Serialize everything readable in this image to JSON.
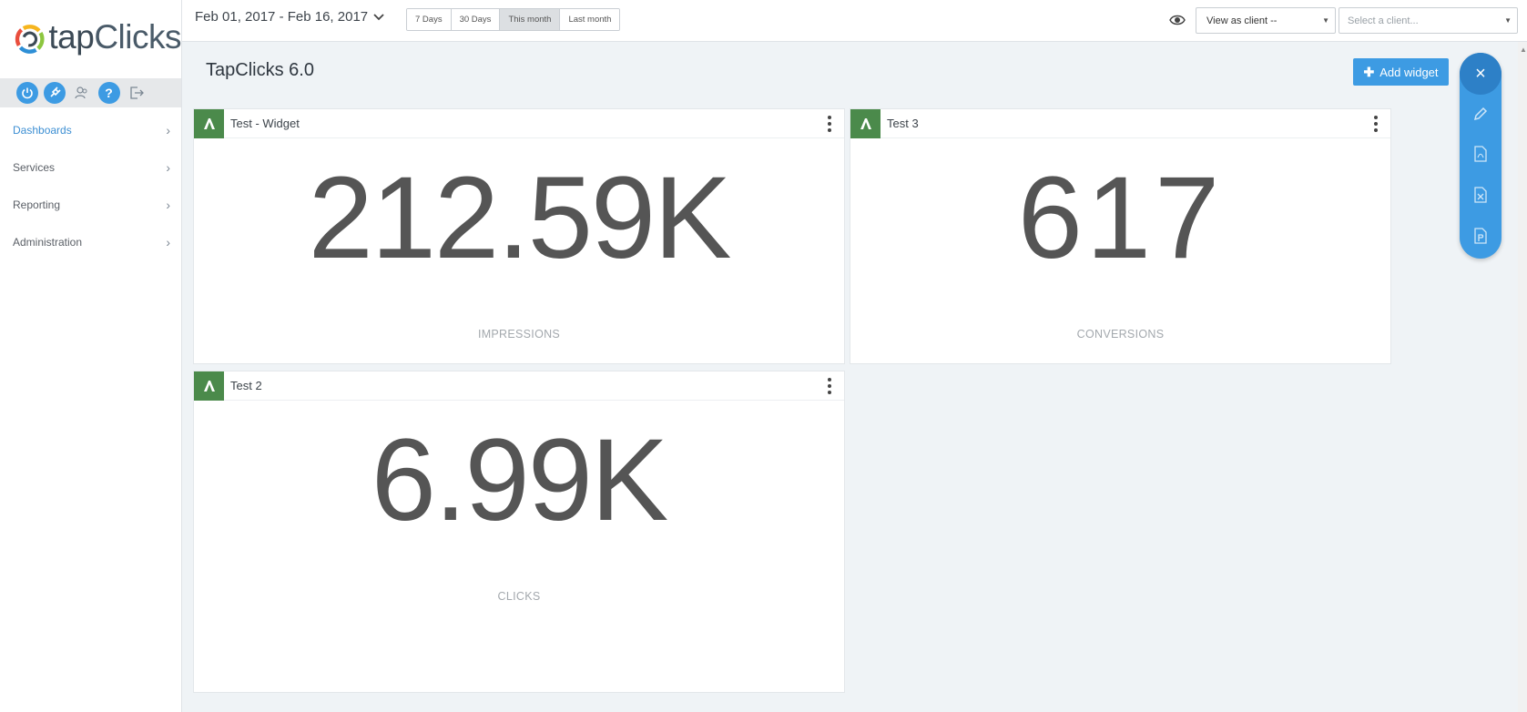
{
  "brand": {
    "logo_tap": "tap",
    "logo_clicks": "Clicks"
  },
  "toolbar": {
    "icons": [
      "power-icon",
      "plug-icon",
      "users-icon",
      "help-icon",
      "logout-icon"
    ],
    "help_label": "?"
  },
  "sidebar": {
    "items": [
      {
        "label": "Dashboards",
        "active": true
      },
      {
        "label": "Services",
        "active": false
      },
      {
        "label": "Reporting",
        "active": false
      },
      {
        "label": "Administration",
        "active": false
      }
    ],
    "chevron": "›"
  },
  "topbar": {
    "date_range": "Feb 01, 2017 - Feb 16, 2017",
    "ranges": [
      {
        "label": "7 Days",
        "active": false
      },
      {
        "label": "30 Days",
        "active": false
      },
      {
        "label": "This month",
        "active": true
      },
      {
        "label": "Last month",
        "active": false
      }
    ],
    "view_as": "View as client --",
    "client_placeholder": "Select a client..."
  },
  "page": {
    "title": "TapClicks 6.0",
    "add_widget_label": "Add widget"
  },
  "widgets": [
    {
      "title": "Test - Widget",
      "value": "212.59K",
      "label": "IMPRESSIONS"
    },
    {
      "title": "Test 3",
      "value": "617",
      "label": "CONVERSIONS"
    },
    {
      "title": "Test 2",
      "value": "6.99K",
      "label": "CLICKS"
    }
  ],
  "fab": {
    "close_label": "×",
    "items": [
      "edit-icon",
      "pdf-export-icon",
      "excel-export-icon",
      "powerpoint-export-icon"
    ]
  },
  "colors": {
    "accent": "#3d9be3",
    "badge": "#4b8a4b",
    "background": "#eff3f6"
  }
}
